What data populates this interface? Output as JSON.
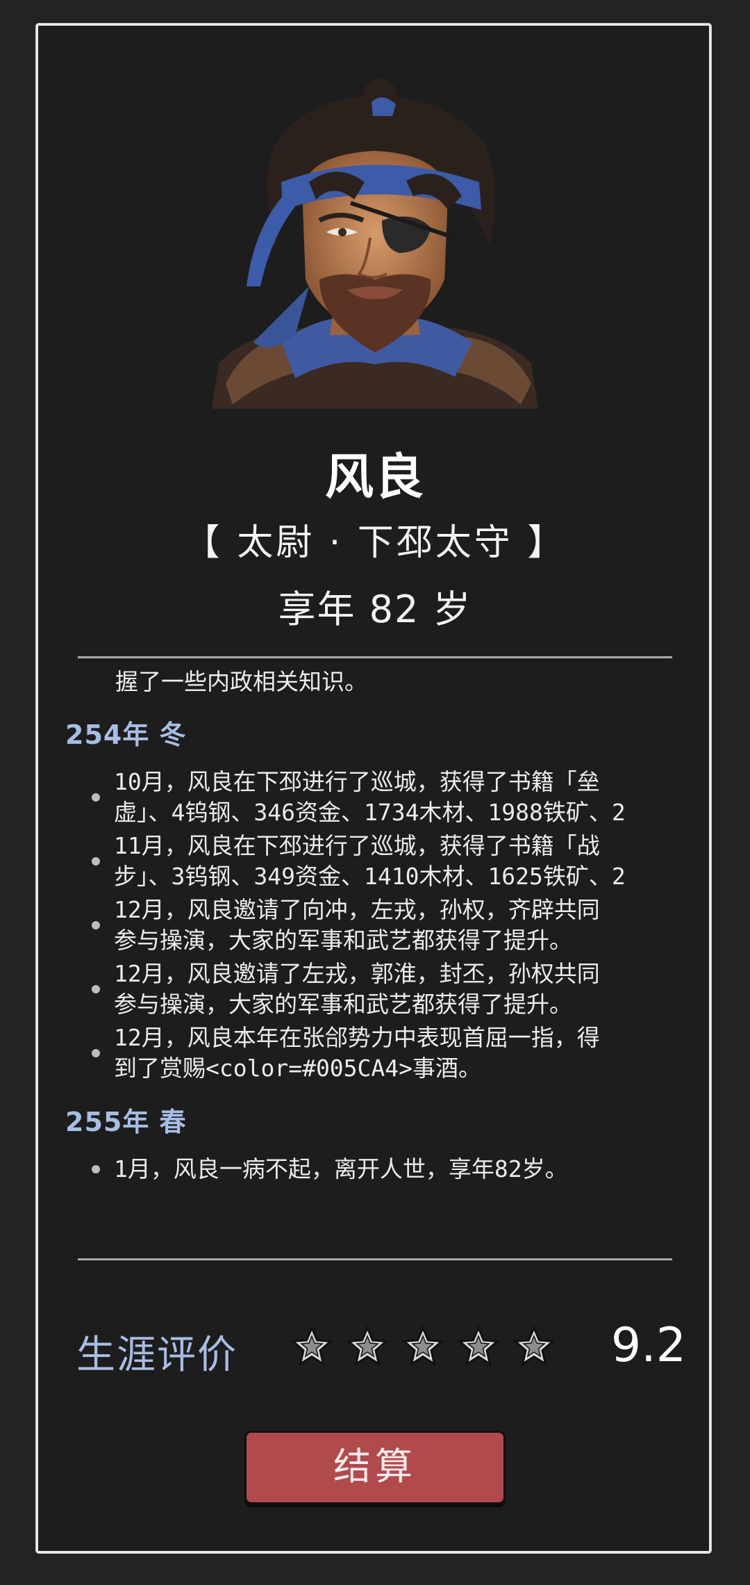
{
  "character": {
    "name": "风良",
    "titles": "【 太尉 · 下邳太守 】",
    "age_text": "享年 82 岁"
  },
  "log": {
    "partial_line": "握了一些内政相关知识。",
    "periods": [
      {
        "label": "254年 冬",
        "entries": [
          "10月，风良在下邳进行了巡城，获得了书籍「垒\n虚」、4钨钢、346资金、1734木材、1988铁矿、2",
          "11月，风良在下邳进行了巡城，获得了书籍「战\n步」、3钨钢、349资金、1410木材、1625铁矿、2",
          "12月，风良邀请了向冲，左戎，孙权，齐辟共同\n参与操演，大家的军事和武艺都获得了提升。",
          "12月，风良邀请了左戎，郭淮，封丕，孙权共同\n参与操演，大家的军事和武艺都获得了提升。",
          "12月，风良本年在张郃势力中表现首屈一指，得\n到了赏赐<color=#005CA4>事酒。"
        ]
      },
      {
        "label": "255年 春",
        "entries": [
          "1月，风良一病不起，离开人世，享年82岁。"
        ]
      }
    ]
  },
  "rating": {
    "label": "生涯评价",
    "stars": 5,
    "score": "9.2"
  },
  "buttons": {
    "settle": "结算"
  },
  "colors": {
    "background": "#1d1d1d",
    "accent_blue": "#a8bde3",
    "button_red": "#b14a4d"
  }
}
